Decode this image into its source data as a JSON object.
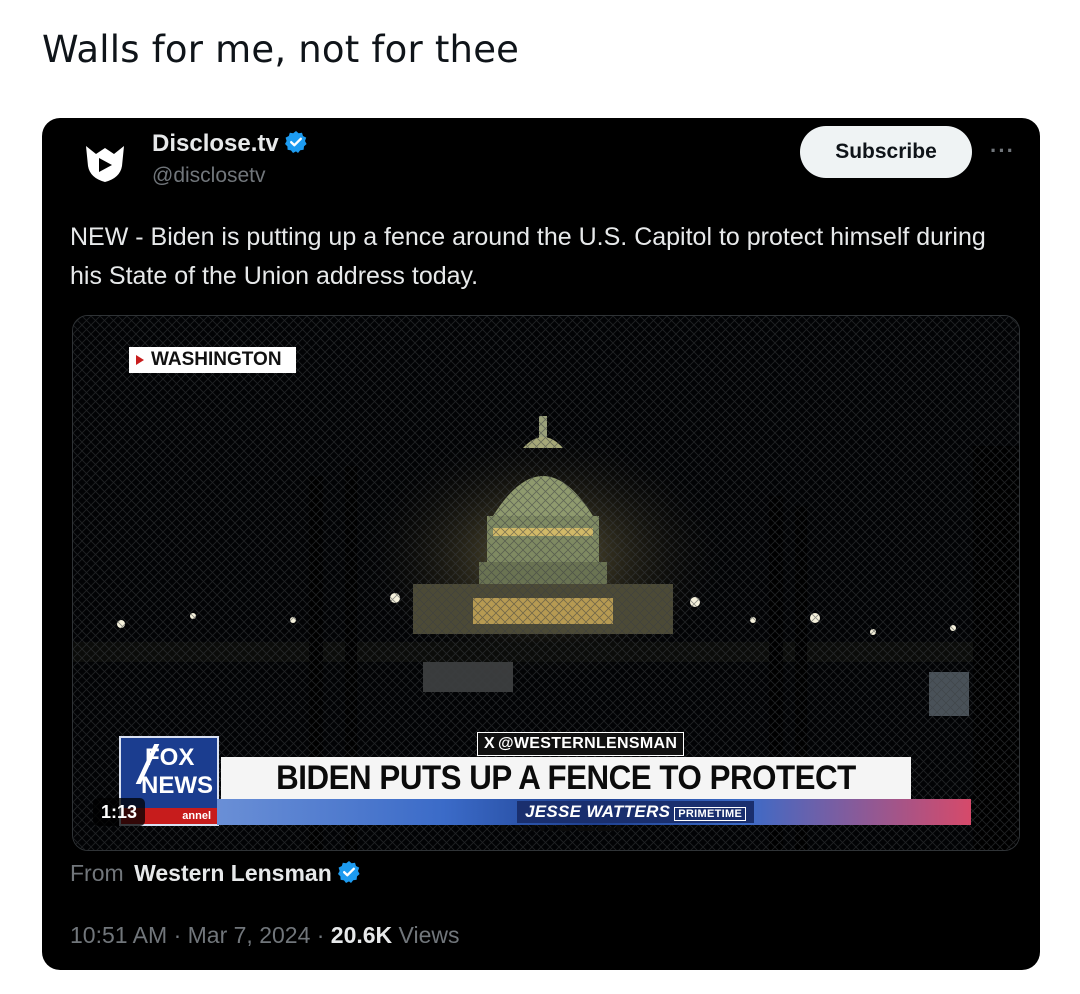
{
  "post": {
    "caption": "Walls for me, not for thee"
  },
  "tweet": {
    "author": {
      "name": "Disclose.tv",
      "handle": "@disclosetv"
    },
    "subscribe_label": "Subscribe",
    "more_label": "···",
    "text": "NEW - Biden is putting up a fence around the U.S. Capitol to protect himself during his State of the Union address today.",
    "media": {
      "location_tag": "WASHINGTON",
      "credit": "@WESTERNLENSMAN",
      "credit_icon": "x-logo-icon",
      "logo_top": "FOX",
      "logo_bottom": "NEWS",
      "logo_channel": "annel",
      "headline": "BIDEN PUTS UP A FENCE TO PROTECT HIMSELF",
      "show_name": "JESSE WATTERS",
      "show_suffix": "PRIMETIME",
      "duration": "1:13"
    },
    "from_prefix": "From",
    "from_source": "Western Lensman",
    "time": "10:51 AM · Mar 7, 2024 · ",
    "views_count": "20.6K",
    "views_label": " Views"
  },
  "colors": {
    "card_bg": "#000000",
    "text_primary": "#e7e9ea",
    "text_secondary": "#71767b",
    "verified": "#1d9bf0",
    "accent_red": "#c81d1d",
    "fox_blue": "#1b3d8f"
  }
}
